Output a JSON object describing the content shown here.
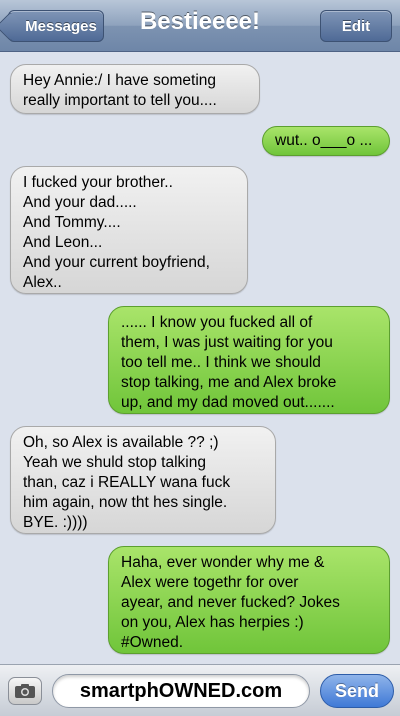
{
  "navbar": {
    "back_label": "Messages",
    "title": "Bestieeee!",
    "edit_label": "Edit"
  },
  "messages": [
    {
      "direction": "received",
      "text": "Hey Annie:/ I have someting\nreally important to tell you...."
    },
    {
      "direction": "sent",
      "text": "wut.. o___o ..."
    },
    {
      "direction": "received",
      "text": "I fucked your brother..\nAnd your dad.....\nAnd Tommy....\nAnd Leon...\nAnd your current boyfriend,\nAlex.."
    },
    {
      "direction": "sent",
      "text": "...... I know you fucked all of\nthem, I was just waiting for you\ntoo tell me.. I think we should\nstop talking, me and Alex broke\nup, and my dad moved out......."
    },
    {
      "direction": "received",
      "text": "Oh, so Alex is available ?? ;)\nYeah we shuld stop talking\nthan, caz i REALLY wana fuck\nhim again, now tht hes single.\nBYE. :))))"
    },
    {
      "direction": "sent",
      "text": "Haha, ever wonder why me &\nAlex were togethr for over\nayear, and never fucked? Jokes\non you, Alex has herpies :)\n#Owned."
    }
  ],
  "composer": {
    "input_value": "smartphOWNED.com",
    "send_label": "Send",
    "camera_icon": "camera-icon"
  },
  "colors": {
    "sent_bubble": "#7ccb42",
    "received_bubble": "#e2e2e2",
    "background": "#dbe1ec",
    "send_button": "#3f79d6"
  }
}
